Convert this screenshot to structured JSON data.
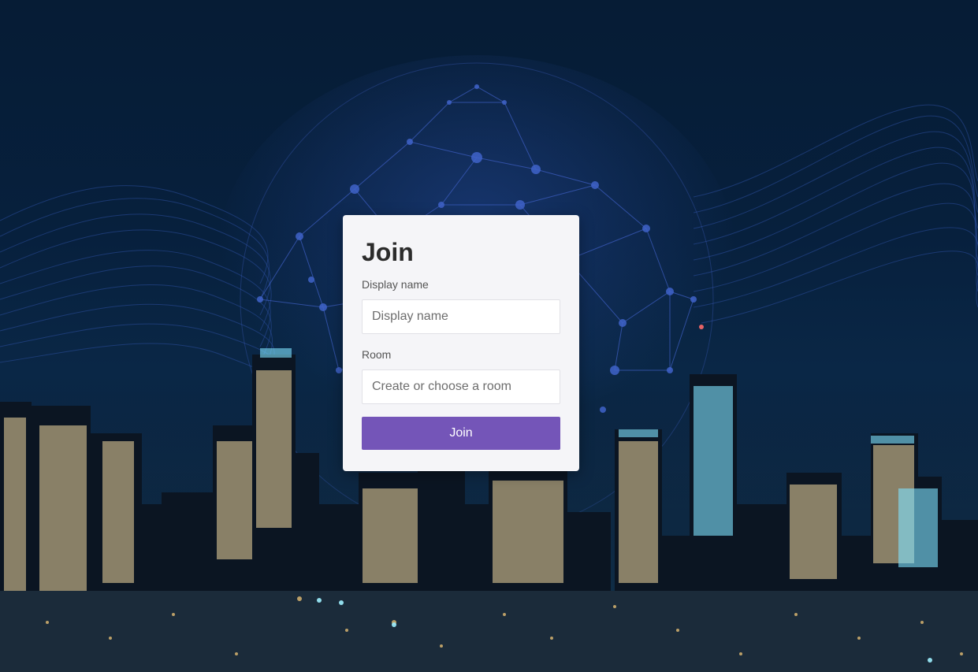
{
  "form": {
    "title": "Join",
    "display_name_label": "Display name",
    "display_name_placeholder": "Display name",
    "display_name_value": "",
    "room_label": "Room",
    "room_placeholder": "Create or choose a room",
    "room_value": "",
    "submit_label": "Join",
    "accent_color": "#7455b8"
  },
  "background": {
    "description_icon": "city-skyline-network-globe-image"
  }
}
